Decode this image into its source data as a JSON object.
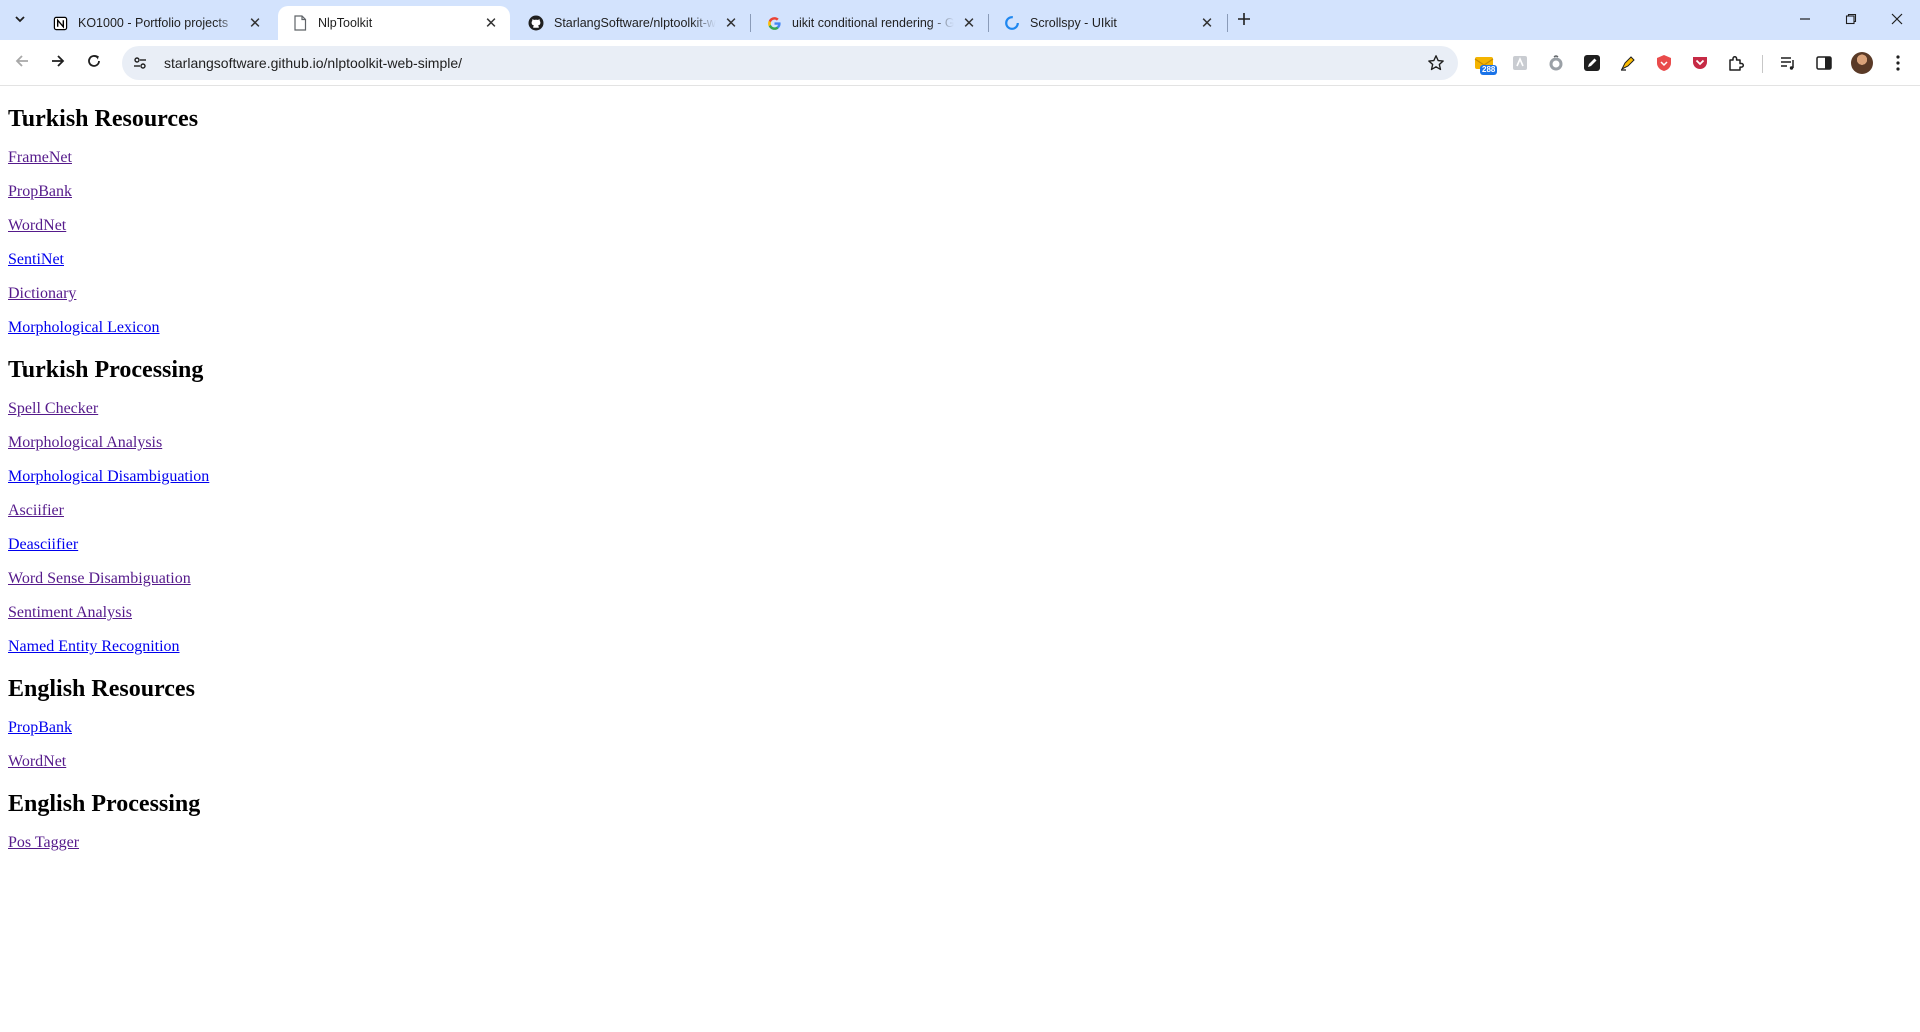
{
  "browser": {
    "tabs": [
      {
        "title": "KO1000 - Portfolio projects",
        "favicon": "notion-icon",
        "active": false
      },
      {
        "title": "NlpToolkit",
        "favicon": "document-icon",
        "active": true
      },
      {
        "title": "StarlangSoftware/nlptoolkit-w",
        "favicon": "github-icon",
        "active": false
      },
      {
        "title": "uikit conditional rendering - G",
        "favicon": "google-icon",
        "active": false
      },
      {
        "title": "Scrollspy - UIkit",
        "favicon": "uikit-icon",
        "active": false
      }
    ],
    "address": "starlangsoftware.github.io/nlptoolkit-web-simple/",
    "extension_badge": "288"
  },
  "page": {
    "sections": [
      {
        "heading": "Turkish Resources",
        "links": [
          {
            "label": "FrameNet",
            "visited": true
          },
          {
            "label": "PropBank",
            "visited": true
          },
          {
            "label": "WordNet",
            "visited": true
          },
          {
            "label": "SentiNet",
            "visited": false
          },
          {
            "label": "Dictionary",
            "visited": true
          },
          {
            "label": "Morphological Lexicon",
            "visited": false
          }
        ]
      },
      {
        "heading": "Turkish Processing",
        "links": [
          {
            "label": "Spell Checker",
            "visited": true
          },
          {
            "label": "Morphological Analysis",
            "visited": true
          },
          {
            "label": "Morphological Disambiguation",
            "visited": false
          },
          {
            "label": "Asciifier",
            "visited": true
          },
          {
            "label": "Deasciifier",
            "visited": false
          },
          {
            "label": "Word Sense Disambiguation",
            "visited": true
          },
          {
            "label": "Sentiment Analysis",
            "visited": true
          },
          {
            "label": "Named Entity Recognition",
            "visited": false
          }
        ]
      },
      {
        "heading": "English Resources",
        "links": [
          {
            "label": "PropBank",
            "visited": false
          },
          {
            "label": "WordNet",
            "visited": true
          }
        ]
      },
      {
        "heading": "English Processing",
        "links": [
          {
            "label": "Pos Tagger",
            "visited": true
          }
        ]
      }
    ]
  },
  "colors": {
    "link": "#0000ee",
    "visited_link": "#551a8b",
    "tabstrip": "#d3e3fd",
    "omnibox": "#e9eef6"
  }
}
